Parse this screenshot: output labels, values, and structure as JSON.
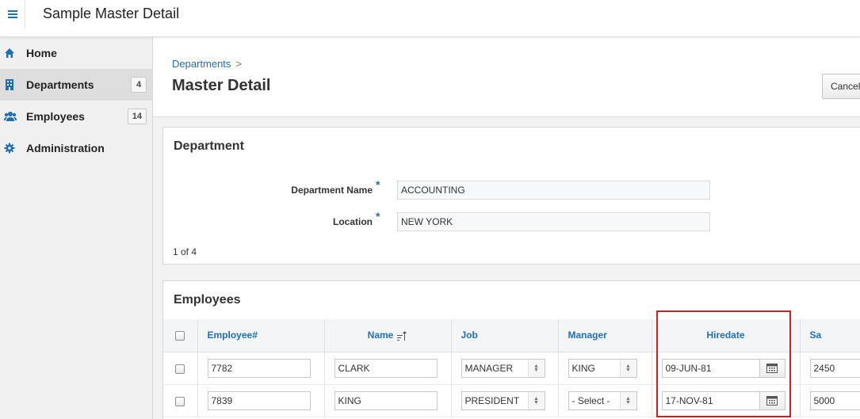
{
  "app": {
    "title": "Sample Master Detail"
  },
  "sidebar": {
    "items": [
      {
        "label": "Home",
        "icon": "home-icon",
        "badge": ""
      },
      {
        "label": "Departments",
        "icon": "building-icon",
        "badge": "4",
        "active": true
      },
      {
        "label": "Employees",
        "icon": "users-icon",
        "badge": "14"
      },
      {
        "label": "Administration",
        "icon": "gear-icon",
        "badge": ""
      }
    ]
  },
  "breadcrumb": {
    "parent": "Departments",
    "separator": ">"
  },
  "page": {
    "title": "Master Detail",
    "cancel_label": "Cancel"
  },
  "department": {
    "region_title": "Department",
    "name_label": "Department Name",
    "name_value": "ACCOUNTING",
    "location_label": "Location",
    "location_value": "NEW YORK",
    "required_mark": "*",
    "pager": "1 of 4"
  },
  "employees": {
    "region_title": "Employees",
    "columns": [
      "Employee#",
      "Name",
      "Job",
      "Manager",
      "Hiredate",
      "Sa"
    ],
    "rows": [
      {
        "empno": "7782",
        "name": "CLARK",
        "job": "MANAGER",
        "manager": "KING",
        "hiredate": "09-JUN-81",
        "sal": "2450"
      },
      {
        "empno": "7839",
        "name": "KING",
        "job": "PRESIDENT",
        "manager": "- Select -",
        "hiredate": "17-NOV-81",
        "sal": "5000"
      }
    ]
  },
  "colors": {
    "accent": "#1f6fb5",
    "highlight": "#d11f1f"
  }
}
